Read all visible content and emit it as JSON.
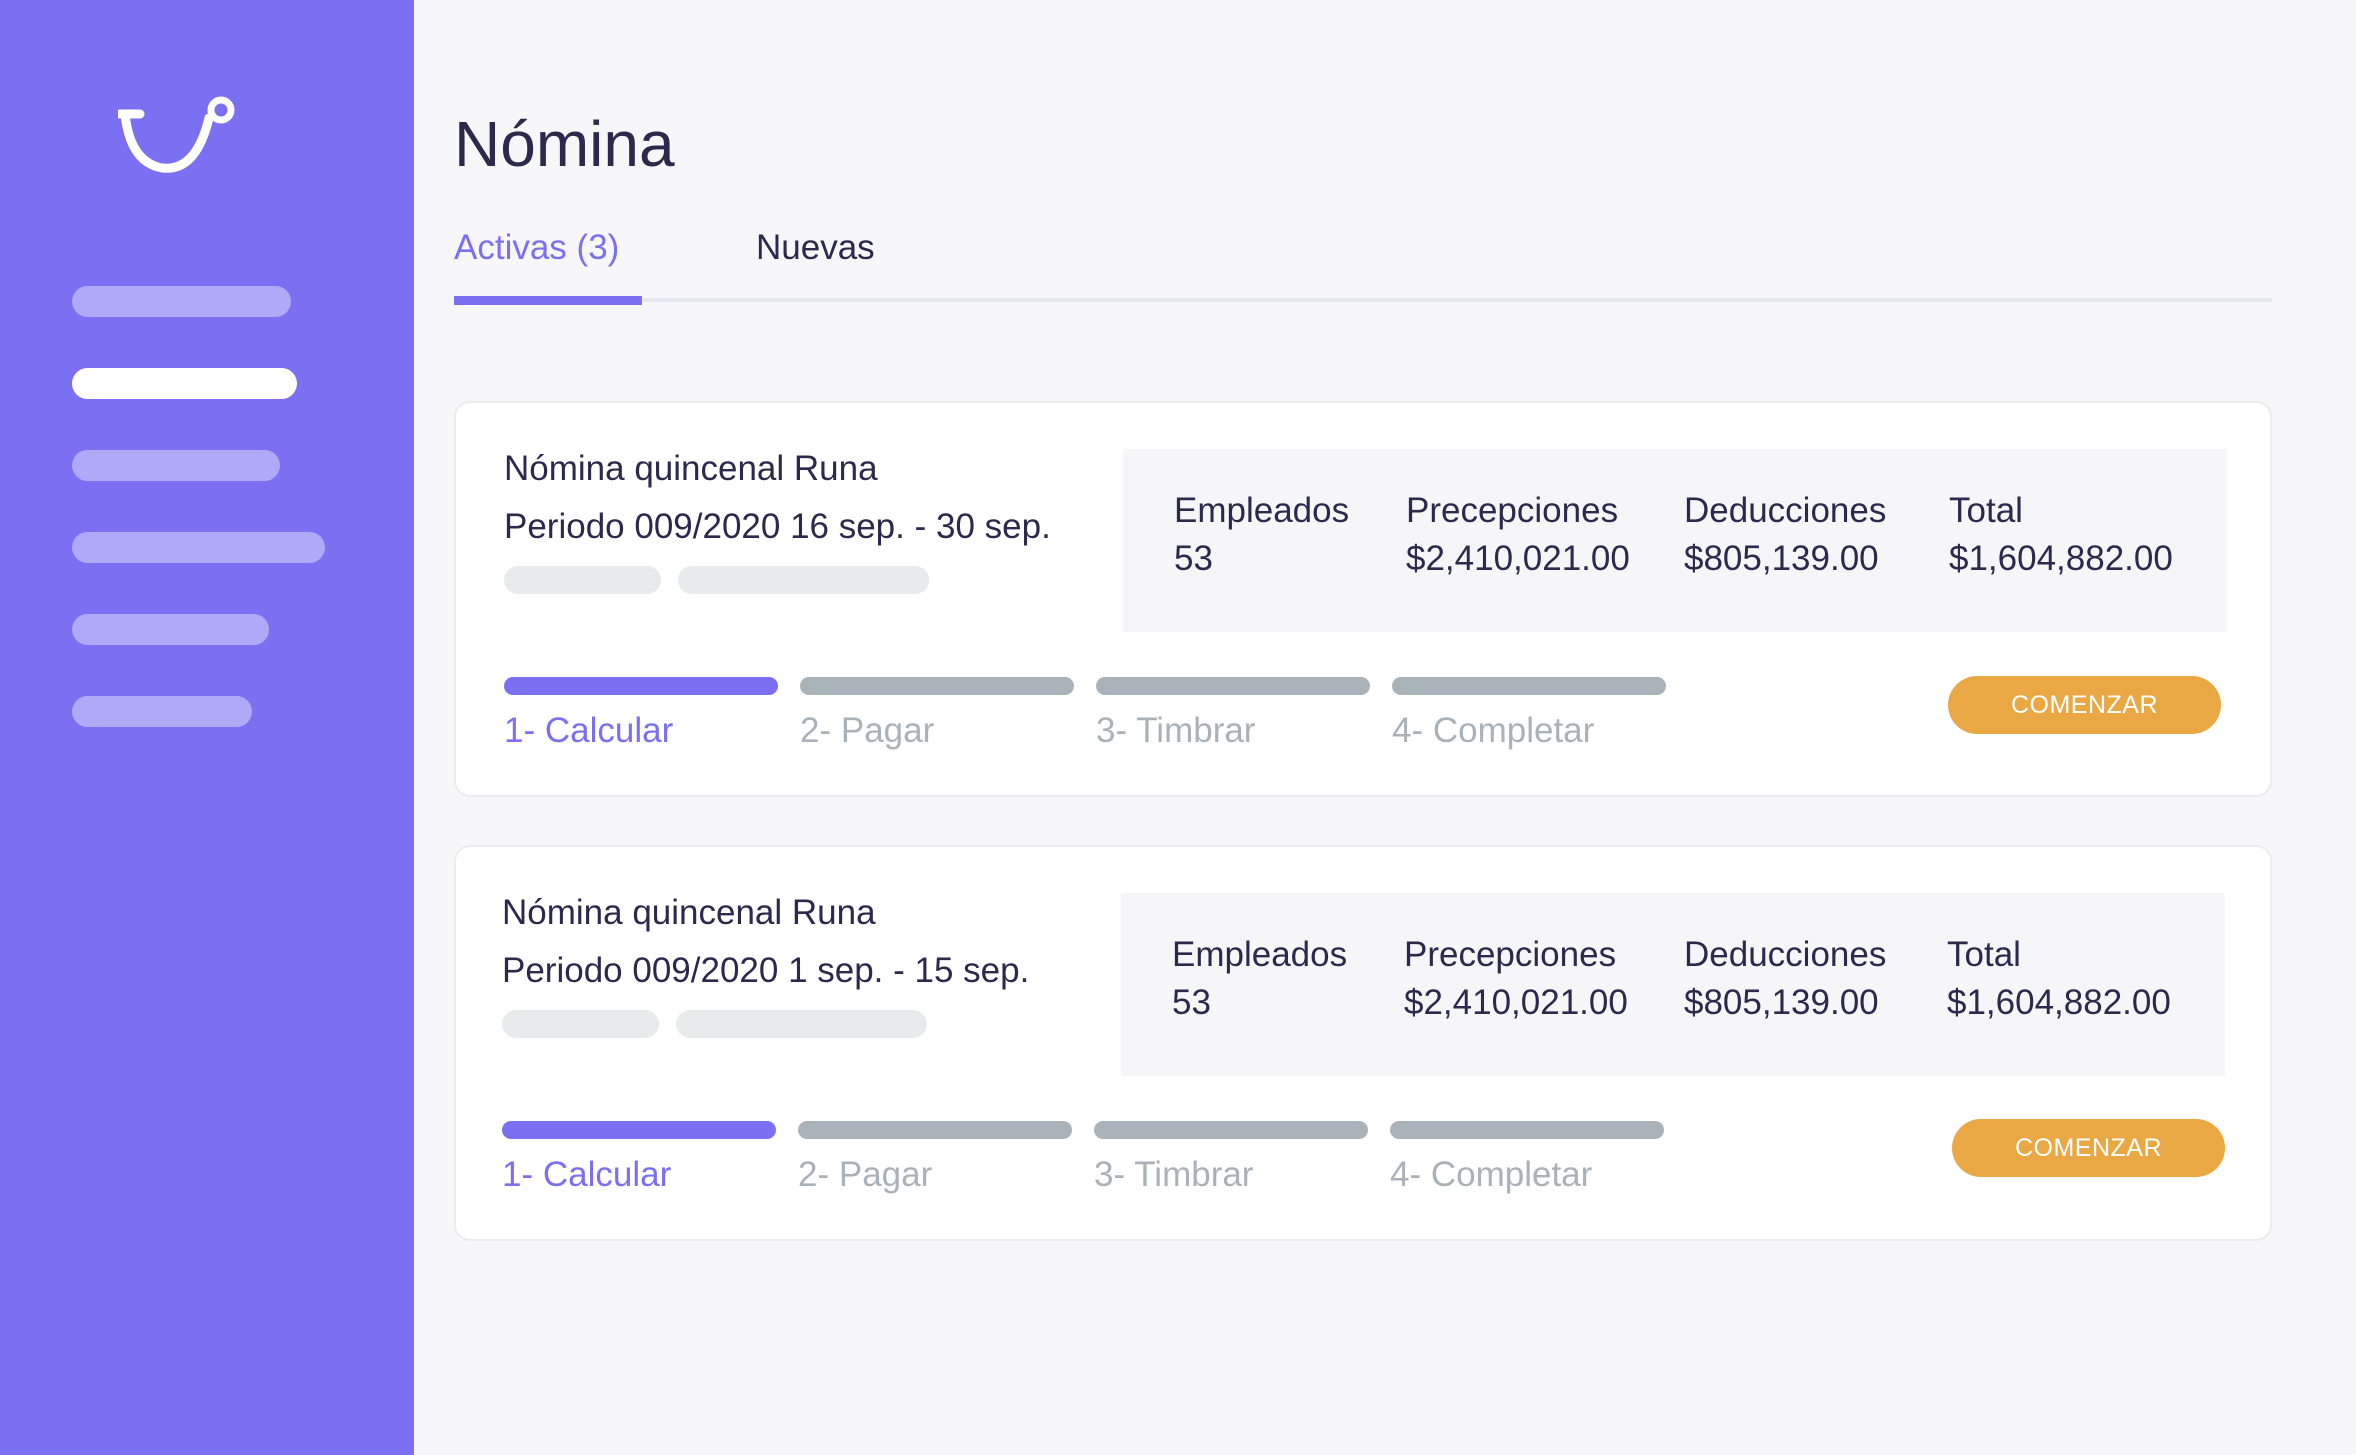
{
  "sidebar": {
    "logo_icon": "smile-hook-logo",
    "nav_item_count_note": null
  },
  "header": {
    "title": "Nómina"
  },
  "tabs": [
    {
      "label": "Activas (3)",
      "active": true
    },
    {
      "label": "Nuevas",
      "active": false
    }
  ],
  "cards": [
    {
      "title": "Nómina quincenal Runa",
      "period": "Periodo 009/2020 16 sep. - 30 sep.",
      "metrics": [
        {
          "label": "Empleados",
          "value": "53"
        },
        {
          "label": "Precepciones",
          "value": "$2,410,021.00"
        },
        {
          "label": "Deducciones",
          "value": "$805,139.00"
        },
        {
          "label": "Total",
          "value": "$1,604,882.00"
        }
      ],
      "steps": [
        {
          "label": "1- Calcular",
          "current": true
        },
        {
          "label": "2- Pagar",
          "current": false
        },
        {
          "label": "3- Timbrar",
          "current": false
        },
        {
          "label": "4- Completar",
          "current": false
        }
      ],
      "action_label": "COMENZAR"
    },
    {
      "title": "Nómina quincenal Runa",
      "period": "Periodo 009/2020 1 sep. - 15 sep.",
      "metrics": [
        {
          "label": "Empleados",
          "value": "53"
        },
        {
          "label": "Precepciones",
          "value": "$2,410,021.00"
        },
        {
          "label": "Deducciones",
          "value": "$805,139.00"
        },
        {
          "label": "Total",
          "value": "$1,604,882.00"
        }
      ],
      "steps": [
        {
          "label": "1- Calcular",
          "current": true
        },
        {
          "label": "2- Pagar",
          "current": false
        },
        {
          "label": "3- Timbrar",
          "current": false
        },
        {
          "label": "4- Completar",
          "current": false
        }
      ],
      "action_label": "COMENZAR"
    }
  ],
  "colors": {
    "sidebar": "#7b70f2",
    "accent": "#7b70f2",
    "button": "#eaa844",
    "step_inactive": "#aab2b9",
    "text": "#2b2a4c"
  }
}
